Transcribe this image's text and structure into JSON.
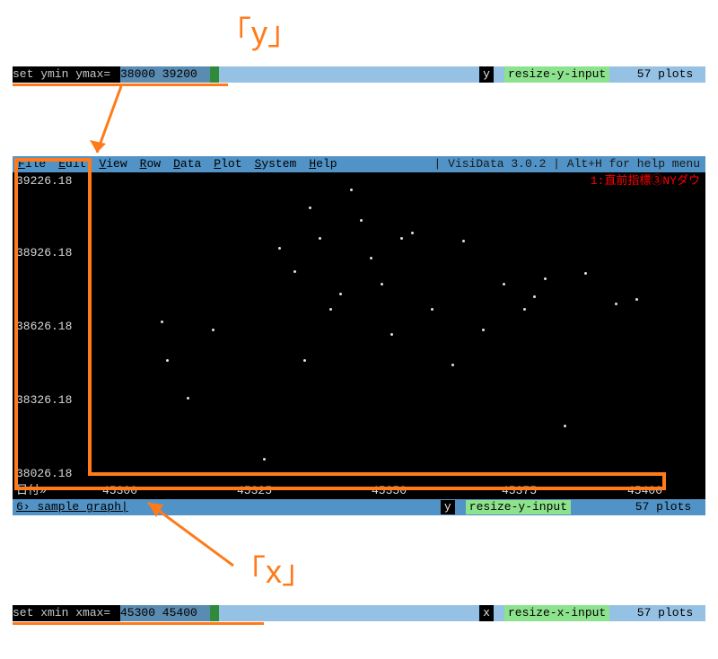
{
  "annotations": {
    "y_label": "「y」",
    "x_label": "「x」"
  },
  "bar_y": {
    "prompt": "set ymin ymax=",
    "value": "38000 39200",
    "key": "y",
    "cmd": "resize-y-input",
    "tail": "57 plots "
  },
  "bar_x": {
    "prompt": "set xmin xmax=",
    "value": "45300 45400",
    "key": "x",
    "cmd": "resize-x-input",
    "tail": "57 plots "
  },
  "menu": {
    "items": [
      "File",
      "Edit",
      "View",
      "Row",
      "Data",
      "Plot",
      "System",
      "Help"
    ],
    "info_left": "| VisiData 3.0.2 | Alt+H for help menu"
  },
  "plot": {
    "legend": "1:直前指標③NYダウ",
    "yticks": [
      "39226.18",
      "38926.18",
      "38626.18",
      "38326.18",
      "38026.18"
    ],
    "xlabel_prefix": "日付»",
    "xticks": [
      "45300",
      "45325",
      "45350",
      "45375",
      "45400"
    ]
  },
  "status": {
    "sheet": "6› sample_graph|",
    "key": "y",
    "cmd": "resize-y-input",
    "tail": "57 plots "
  },
  "chart_data": {
    "type": "scatter",
    "title": "直前指標③NYダウ",
    "xlabel": "日付",
    "ylabel": "",
    "xlim": [
      45290,
      45410
    ],
    "ylim": [
      38026.18,
      39226.18
    ],
    "series": [
      {
        "name": "直前指標③NYダウ",
        "x": [
          45305,
          45306,
          45310,
          45315,
          45325,
          45328,
          45331,
          45333,
          45334,
          45336,
          45338,
          45340,
          45342,
          45344,
          45346,
          45348,
          45350,
          45352,
          45354,
          45358,
          45362,
          45364,
          45368,
          45372,
          45376,
          45378,
          45380,
          45384,
          45388,
          45394,
          45398
        ],
        "y": [
          38650,
          38500,
          38350,
          38620,
          38110,
          38940,
          38850,
          38500,
          39100,
          38980,
          38700,
          38760,
          39170,
          39050,
          38900,
          38800,
          38600,
          38980,
          39000,
          38700,
          38480,
          38970,
          38620,
          38800,
          38700,
          38750,
          38820,
          38240,
          38840,
          38720,
          38740
        ]
      }
    ]
  }
}
